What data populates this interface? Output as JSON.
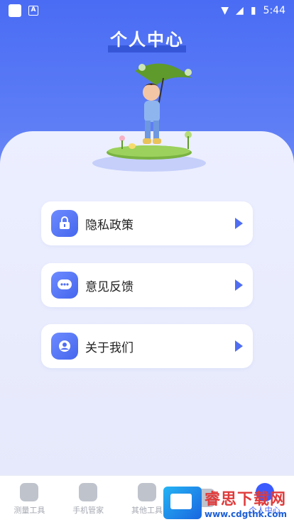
{
  "status_bar": {
    "time": "5:44"
  },
  "header": {
    "title": "个人中心"
  },
  "menu": [
    {
      "label": "隐私政策",
      "icon": "lock-icon"
    },
    {
      "label": "意见反馈",
      "icon": "chat-bubble-icon"
    },
    {
      "label": "关于我们",
      "icon": "info-icon"
    }
  ],
  "bottom_nav": [
    {
      "label": "测量工具",
      "icon": "measure-icon"
    },
    {
      "label": "手机管家",
      "icon": "phone-manager-icon"
    },
    {
      "label": "其他工具",
      "icon": "layers-icon"
    },
    {
      "label": "",
      "icon": "tools-icon"
    },
    {
      "label": "个人中心",
      "icon": "profile-icon",
      "active": true
    }
  ],
  "watermark": {
    "name": "睿思下载网",
    "url": "www.cdgthk.com"
  },
  "colors": {
    "primary": "#4a6cf4",
    "accent": "#3b5bff",
    "arrow": "#4f6df3"
  }
}
